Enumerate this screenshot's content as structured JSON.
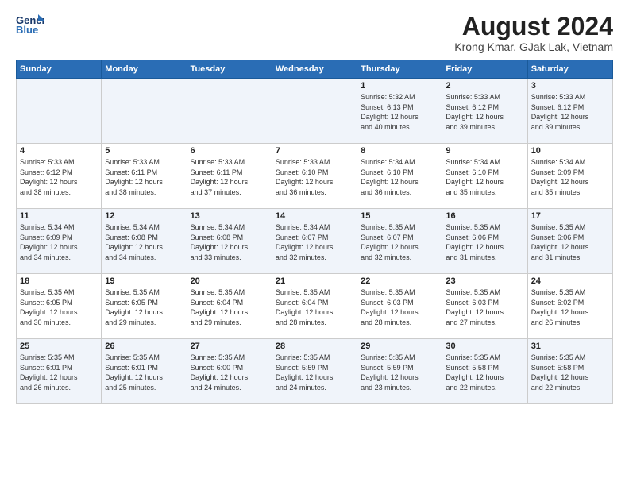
{
  "header": {
    "logo_line1": "General",
    "logo_line2": "Blue",
    "title": "August 2024",
    "subtitle": "Krong Kmar, GJak Lak, Vietnam"
  },
  "days_of_week": [
    "Sunday",
    "Monday",
    "Tuesday",
    "Wednesday",
    "Thursday",
    "Friday",
    "Saturday"
  ],
  "weeks": [
    [
      {
        "num": "",
        "info": ""
      },
      {
        "num": "",
        "info": ""
      },
      {
        "num": "",
        "info": ""
      },
      {
        "num": "",
        "info": ""
      },
      {
        "num": "1",
        "info": "Sunrise: 5:32 AM\nSunset: 6:13 PM\nDaylight: 12 hours\nand 40 minutes."
      },
      {
        "num": "2",
        "info": "Sunrise: 5:33 AM\nSunset: 6:12 PM\nDaylight: 12 hours\nand 39 minutes."
      },
      {
        "num": "3",
        "info": "Sunrise: 5:33 AM\nSunset: 6:12 PM\nDaylight: 12 hours\nand 39 minutes."
      }
    ],
    [
      {
        "num": "4",
        "info": "Sunrise: 5:33 AM\nSunset: 6:12 PM\nDaylight: 12 hours\nand 38 minutes."
      },
      {
        "num": "5",
        "info": "Sunrise: 5:33 AM\nSunset: 6:11 PM\nDaylight: 12 hours\nand 38 minutes."
      },
      {
        "num": "6",
        "info": "Sunrise: 5:33 AM\nSunset: 6:11 PM\nDaylight: 12 hours\nand 37 minutes."
      },
      {
        "num": "7",
        "info": "Sunrise: 5:33 AM\nSunset: 6:10 PM\nDaylight: 12 hours\nand 36 minutes."
      },
      {
        "num": "8",
        "info": "Sunrise: 5:34 AM\nSunset: 6:10 PM\nDaylight: 12 hours\nand 36 minutes."
      },
      {
        "num": "9",
        "info": "Sunrise: 5:34 AM\nSunset: 6:10 PM\nDaylight: 12 hours\nand 35 minutes."
      },
      {
        "num": "10",
        "info": "Sunrise: 5:34 AM\nSunset: 6:09 PM\nDaylight: 12 hours\nand 35 minutes."
      }
    ],
    [
      {
        "num": "11",
        "info": "Sunrise: 5:34 AM\nSunset: 6:09 PM\nDaylight: 12 hours\nand 34 minutes."
      },
      {
        "num": "12",
        "info": "Sunrise: 5:34 AM\nSunset: 6:08 PM\nDaylight: 12 hours\nand 34 minutes."
      },
      {
        "num": "13",
        "info": "Sunrise: 5:34 AM\nSunset: 6:08 PM\nDaylight: 12 hours\nand 33 minutes."
      },
      {
        "num": "14",
        "info": "Sunrise: 5:34 AM\nSunset: 6:07 PM\nDaylight: 12 hours\nand 32 minutes."
      },
      {
        "num": "15",
        "info": "Sunrise: 5:35 AM\nSunset: 6:07 PM\nDaylight: 12 hours\nand 32 minutes."
      },
      {
        "num": "16",
        "info": "Sunrise: 5:35 AM\nSunset: 6:06 PM\nDaylight: 12 hours\nand 31 minutes."
      },
      {
        "num": "17",
        "info": "Sunrise: 5:35 AM\nSunset: 6:06 PM\nDaylight: 12 hours\nand 31 minutes."
      }
    ],
    [
      {
        "num": "18",
        "info": "Sunrise: 5:35 AM\nSunset: 6:05 PM\nDaylight: 12 hours\nand 30 minutes."
      },
      {
        "num": "19",
        "info": "Sunrise: 5:35 AM\nSunset: 6:05 PM\nDaylight: 12 hours\nand 29 minutes."
      },
      {
        "num": "20",
        "info": "Sunrise: 5:35 AM\nSunset: 6:04 PM\nDaylight: 12 hours\nand 29 minutes."
      },
      {
        "num": "21",
        "info": "Sunrise: 5:35 AM\nSunset: 6:04 PM\nDaylight: 12 hours\nand 28 minutes."
      },
      {
        "num": "22",
        "info": "Sunrise: 5:35 AM\nSunset: 6:03 PM\nDaylight: 12 hours\nand 28 minutes."
      },
      {
        "num": "23",
        "info": "Sunrise: 5:35 AM\nSunset: 6:03 PM\nDaylight: 12 hours\nand 27 minutes."
      },
      {
        "num": "24",
        "info": "Sunrise: 5:35 AM\nSunset: 6:02 PM\nDaylight: 12 hours\nand 26 minutes."
      }
    ],
    [
      {
        "num": "25",
        "info": "Sunrise: 5:35 AM\nSunset: 6:01 PM\nDaylight: 12 hours\nand 26 minutes."
      },
      {
        "num": "26",
        "info": "Sunrise: 5:35 AM\nSunset: 6:01 PM\nDaylight: 12 hours\nand 25 minutes."
      },
      {
        "num": "27",
        "info": "Sunrise: 5:35 AM\nSunset: 6:00 PM\nDaylight: 12 hours\nand 24 minutes."
      },
      {
        "num": "28",
        "info": "Sunrise: 5:35 AM\nSunset: 5:59 PM\nDaylight: 12 hours\nand 24 minutes."
      },
      {
        "num": "29",
        "info": "Sunrise: 5:35 AM\nSunset: 5:59 PM\nDaylight: 12 hours\nand 23 minutes."
      },
      {
        "num": "30",
        "info": "Sunrise: 5:35 AM\nSunset: 5:58 PM\nDaylight: 12 hours\nand 22 minutes."
      },
      {
        "num": "31",
        "info": "Sunrise: 5:35 AM\nSunset: 5:58 PM\nDaylight: 12 hours\nand 22 minutes."
      }
    ]
  ]
}
